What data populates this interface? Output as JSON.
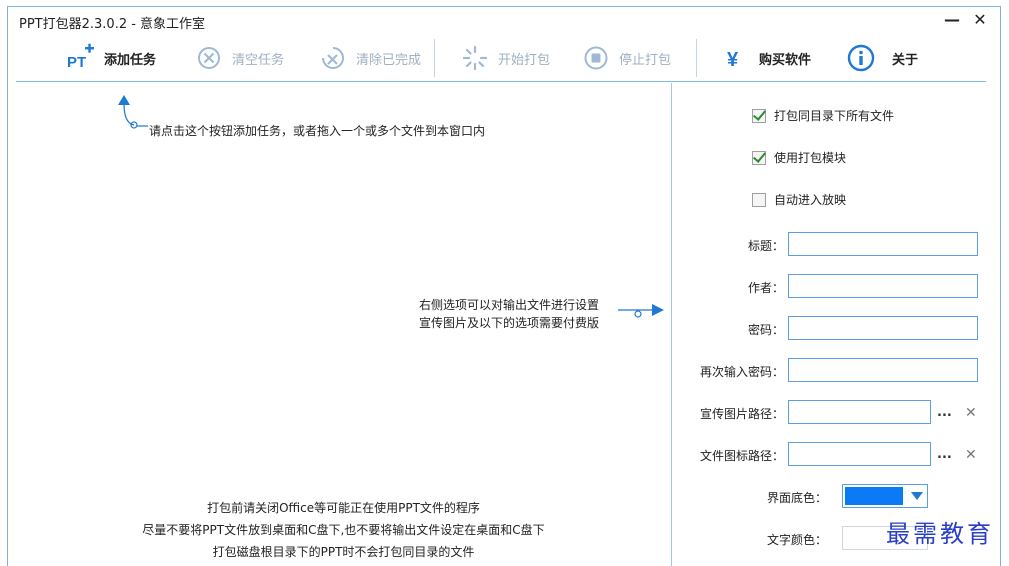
{
  "window": {
    "title": "PPT打包器2.3.0.2 - 意象工作室",
    "minimize": "—",
    "close": "✕"
  },
  "toolbar": {
    "add_task": "添加任务",
    "clear_tasks": "清空任务",
    "clear_done": "清除已完成",
    "start_pack": "开始打包",
    "stop_pack": "停止打包",
    "buy": "购买软件",
    "about": "关于",
    "add_icon_text": "PT",
    "buy_icon_text": "¥"
  },
  "main": {
    "hint_top": "请点击这个按钮添加任务，或者拖入一个或多个文件到本窗口内",
    "hint_right_1": "右侧选项可以对输出文件进行设置",
    "hint_right_2": "宣传图片及以下的选项需要付费版",
    "hint_bottom_1": "打包前请关闭Office等可能正在使用PPT文件的程序",
    "hint_bottom_2": "尽量不要将PPT文件放到桌面和C盘下,也不要将输出文件设定在桌面和C盘下",
    "hint_bottom_3": "打包磁盘根目录下的PPT时不会打包同目录的文件"
  },
  "panel": {
    "checkboxes": [
      {
        "label": "打包同目录下所有文件",
        "checked": true
      },
      {
        "label": "使用打包模块",
        "checked": true
      },
      {
        "label": "自动进入放映",
        "checked": false
      }
    ],
    "fields": {
      "title_label": "标题：",
      "title_value": "",
      "author_label": "作者：",
      "author_value": "",
      "password_label": "密码：",
      "password_value": "",
      "password2_label": "再次输入密码：",
      "password2_value": "",
      "promo_label": "宣传图片路径：",
      "promo_value": "",
      "icon_label": "文件图标路径：",
      "icon_value": "",
      "browse": "...",
      "clear": "✕",
      "bg_color_label": "界面底色：",
      "bg_color": "#0a7af5",
      "text_color_label": "文字颜色："
    }
  },
  "watermark": "最需教育",
  "colors": {
    "accent": "#1f78d1",
    "border": "#5aa0e0",
    "disabled": "#9fb0c0"
  }
}
